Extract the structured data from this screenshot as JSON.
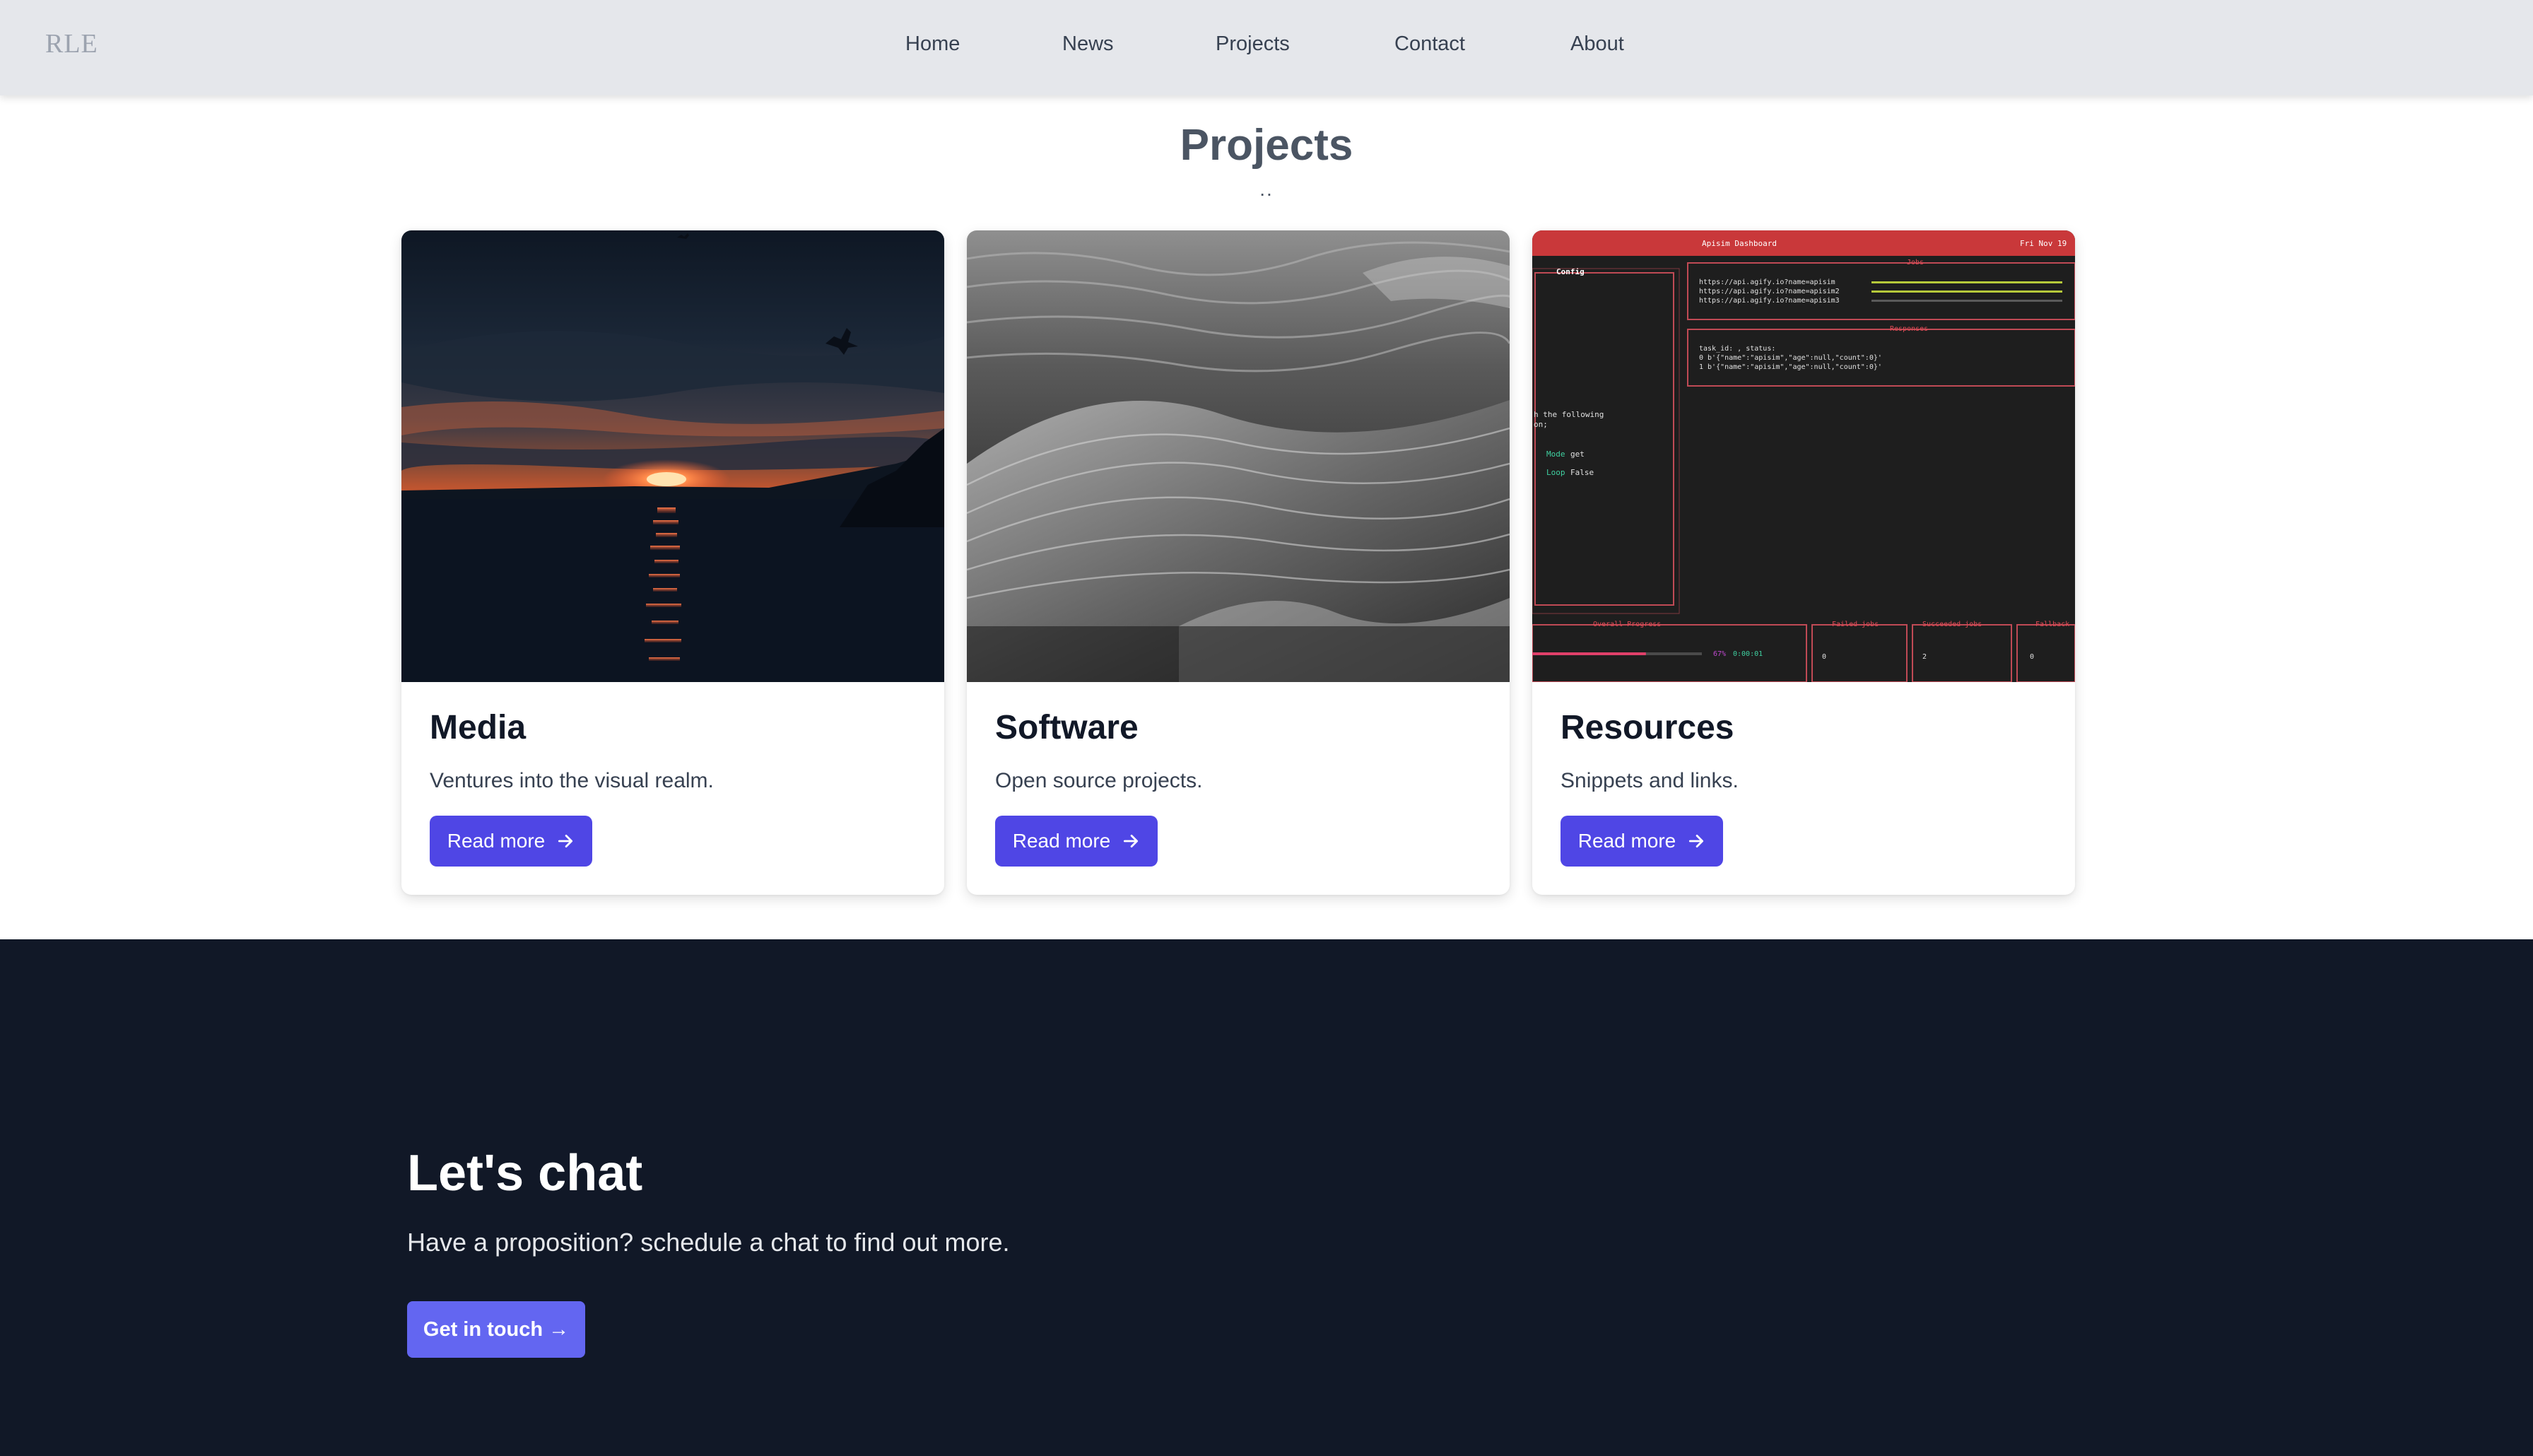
{
  "nav": {
    "logo": "RLE",
    "items": [
      {
        "label": "Home"
      },
      {
        "label": "News"
      },
      {
        "label": "Projects"
      },
      {
        "label": "Contact"
      },
      {
        "label": "About"
      }
    ]
  },
  "projects": {
    "title": "Projects",
    "subtitle": "..",
    "cards": [
      {
        "title": "Media",
        "description": "Ventures into the visual realm.",
        "button": "Read more",
        "image": "sunset-over-water-photo"
      },
      {
        "title": "Software",
        "description": "Open source projects.",
        "button": "Read more",
        "image": "ocean-waves-photo"
      },
      {
        "title": "Resources",
        "description": "Snippets and links.",
        "button": "Read more",
        "image": "apisim-dashboard-screenshot"
      }
    ]
  },
  "dashboard": {
    "header": "Apisim Dashboard",
    "date": "Fri Nov 19",
    "config_label": "Config",
    "jobs_label": "Jobs",
    "job_urls": [
      "https://api.agify.io?name=apisim",
      "https://api.agify.io?name=apisim2",
      "https://api.agify.io?name=apisim3"
    ],
    "responses_label": "Responses",
    "responses": [
      "task_id: , status:",
      "0 b'{\"name\":\"apisim\",\"age\":null,\"count\":0}'",
      "1 b'{\"name\":\"apisim\",\"age\":null,\"count\":0}'"
    ],
    "config_lines": [
      "h the following",
      "on;"
    ],
    "mode_key": "Mode",
    "mode_val": "get",
    "loop_key": "Loop",
    "loop_val": "False",
    "progress_label": "Overall Progress",
    "progress_pct": "67%",
    "progress_value": 0.67,
    "progress_time": "0:00:01",
    "failed_label": "Failed jobs",
    "failed_val": "0",
    "succeeded_label": "Succeeded jobs",
    "succeeded_val": "2",
    "fallback_label": "Fallback",
    "fallback_val": "0"
  },
  "cta": {
    "title": "Let's chat",
    "text": "Have a proposition? schedule a chat to find out more.",
    "button": "Get in touch →"
  },
  "colors": {
    "nav_bg": "#e5e7eb",
    "accent": "#4f46e5",
    "cta_bg": "#111827",
    "cta_button": "#6366f1"
  }
}
